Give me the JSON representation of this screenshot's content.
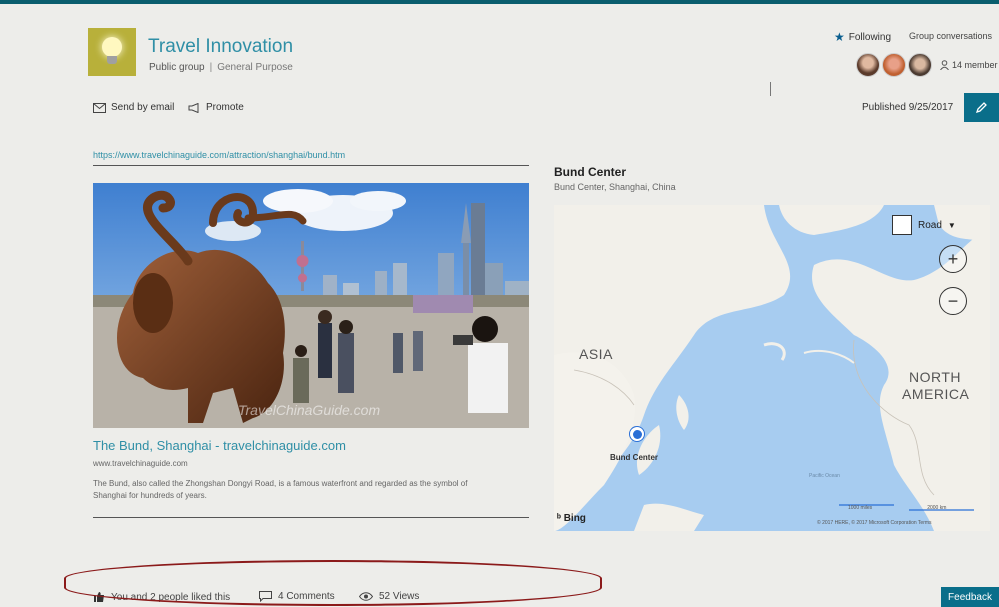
{
  "site": {
    "title": "Travel Innovation",
    "privacy": "Public group",
    "classification": "General Purpose"
  },
  "header": {
    "following": "Following",
    "group_conversations": "Group conversations",
    "members": "14 member"
  },
  "commands": {
    "send_email": "Send by email",
    "promote": "Promote",
    "published": "Published 9/25/2017"
  },
  "link": {
    "url": "https://www.travelchinaguide.com/attraction/shanghai/bund.htm",
    "title": "The Bund, Shanghai - travelchinaguide.com",
    "source": "www.travelchinaguide.com",
    "description": "The Bund, also called the Zhongshan Dongyi Road, is a famous waterfront and regarded as the symbol of Shanghai for hundreds of years.",
    "watermark": "TravelChinaGuide.com"
  },
  "map": {
    "title": "Bund Center",
    "address": "Bund Center, Shanghai, China",
    "style": "Road",
    "label_asia": "ASIA",
    "label_na_line1": "NORTH",
    "label_na_line2": "AMERICA",
    "pin_label": "Bund Center",
    "brand": "Bing",
    "copyright": "© 2017 HERE, © 2017 Microsoft Corporation  Terms",
    "scale_km": "2000 km",
    "scale_mi": "1000 miles",
    "ocean_label": "Pacific Ocean"
  },
  "footer": {
    "likes": "You and 2 people liked this",
    "comments": "4 Comments",
    "views": "52 Views",
    "feedback": "Feedback"
  },
  "colors": {
    "accent": "#0a6e8a",
    "link": "#2f8fa6",
    "highlight": "#8b1a1a"
  }
}
